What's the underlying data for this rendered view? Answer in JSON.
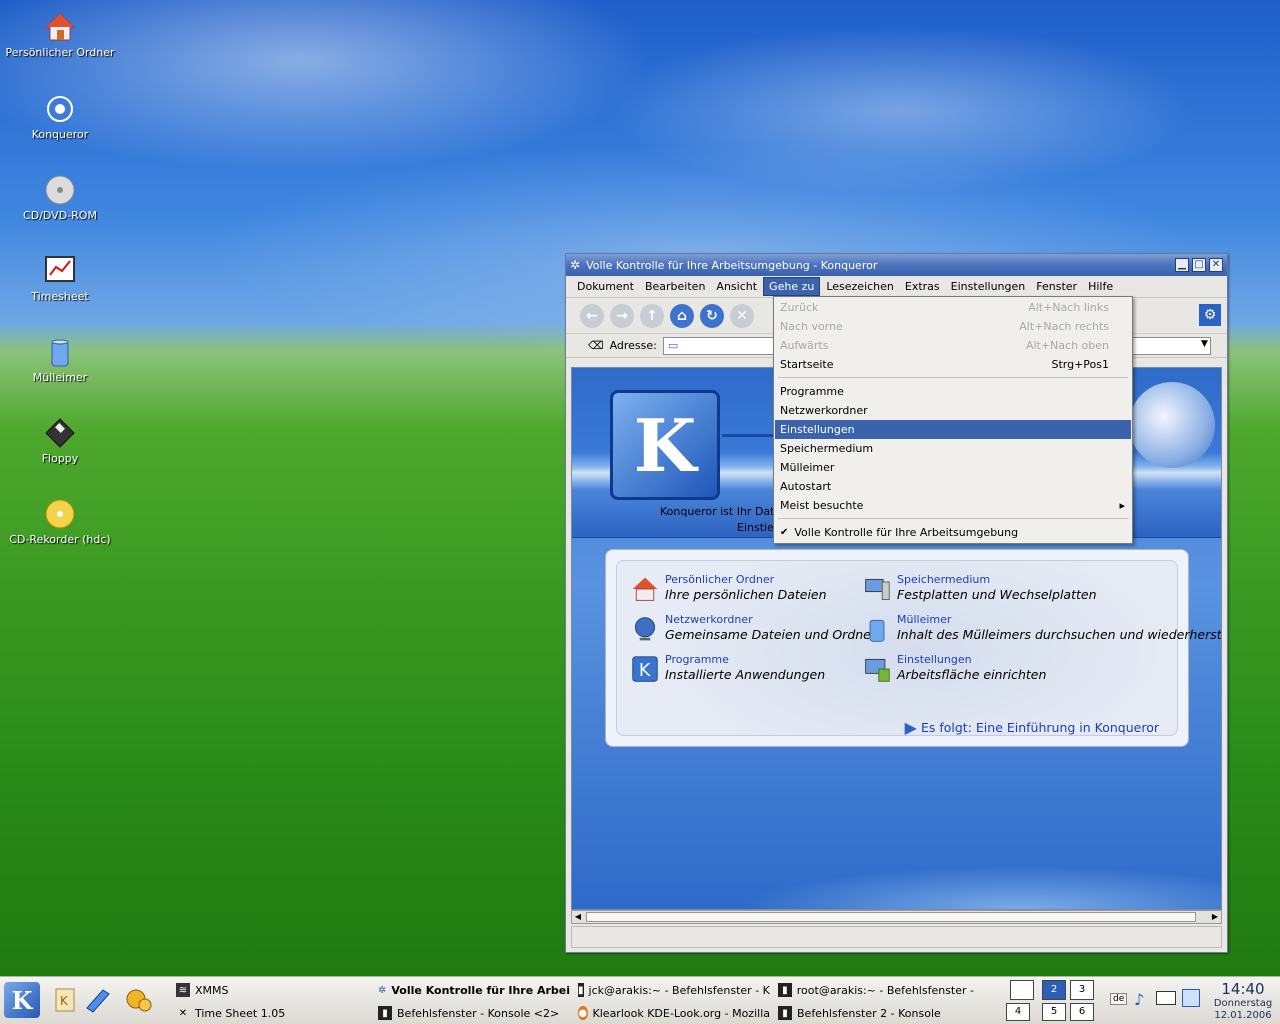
{
  "desktop": {
    "icons": [
      {
        "label": "Persönlicher Ordner",
        "icon": "home-folder-icon"
      },
      {
        "label": "Konqueror",
        "icon": "konqueror-globe-icon"
      },
      {
        "label": "CD/DVD-ROM",
        "icon": "cdrom-icon"
      },
      {
        "label": "Timesheet",
        "icon": "timesheet-icon"
      },
      {
        "label": "Mülleimer",
        "icon": "trash-icon"
      },
      {
        "label": "Floppy",
        "icon": "floppy-icon"
      },
      {
        "label": "CD-Rekorder (hdc)",
        "icon": "cd-writer-icon"
      }
    ]
  },
  "window": {
    "title": "Volle Kontrolle für Ihre Arbeitsumgebung - Konqueror",
    "controls": {
      "minimize": "▁",
      "maximize": "□",
      "close": "✕"
    },
    "menu": [
      "Dokument",
      "Bearbeiten",
      "Ansicht",
      "Gehe zu",
      "Lesezeichen",
      "Extras",
      "Einstellungen",
      "Fenster",
      "Hilfe"
    ],
    "active_menu": "Gehe zu",
    "address_label": "Adresse:",
    "banner_text": [
      "Konqueror ist Ihr Dat",
      "Einstie"
    ],
    "links": [
      {
        "title": "Persönlicher Ordner",
        "desc": "Ihre persönlichen Dateien",
        "icon": "home-folder-icon"
      },
      {
        "title": "Speichermedium",
        "desc": "Festplatten und Wechselplatten",
        "icon": "storage-media-icon"
      },
      {
        "title": "Netzwerkordner",
        "desc": "Gemeinsame Dateien und Ordner",
        "icon": "network-folder-icon"
      },
      {
        "title": "Mülleimer",
        "desc": "Inhalt des Mülleimers durchsuchen und wiederherstelle",
        "icon": "trash-icon"
      },
      {
        "title": "Programme",
        "desc": "Installierte Anwendungen",
        "icon": "applications-icon"
      },
      {
        "title": "Einstellungen",
        "desc": "Arbeitsfläche einrichten",
        "icon": "settings-icon"
      }
    ],
    "next_link": "Es folgt: Eine Einführung in Konqueror"
  },
  "gehezu_menu": {
    "items": [
      {
        "label": "Zurück",
        "shortcut": "Alt+Nach links",
        "disabled": true
      },
      {
        "label": "Nach vorne",
        "shortcut": "Alt+Nach rechts",
        "disabled": true
      },
      {
        "label": "Aufwärts",
        "shortcut": "Alt+Nach oben",
        "disabled": true
      },
      {
        "label": "Startseite",
        "shortcut": "Strg+Pos1",
        "disabled": false
      },
      {
        "label": "Programme",
        "shortcut": "",
        "disabled": false
      },
      {
        "label": "Netzwerkordner",
        "shortcut": "",
        "disabled": false
      },
      {
        "label": "Einstellungen",
        "shortcut": "",
        "disabled": false,
        "selected": true
      },
      {
        "label": "Speichermedium",
        "shortcut": "",
        "disabled": false
      },
      {
        "label": "Mülleimer",
        "shortcut": "",
        "disabled": false
      },
      {
        "label": "Autostart",
        "shortcut": "",
        "disabled": false
      },
      {
        "label": "Meist besuchte",
        "shortcut": "",
        "disabled": false,
        "submenu": true
      },
      {
        "label": "Volle Kontrolle für Ihre Arbeitsumgebung",
        "shortcut": "",
        "disabled": false,
        "checked": true
      }
    ],
    "submenu_arrow": "▸",
    "check_mark": "✔"
  },
  "taskbar": {
    "tasks": [
      {
        "label": "XMMS",
        "icon": "xmms-icon"
      },
      {
        "label": "Time Sheet 1.05",
        "icon": "x-icon"
      },
      {
        "label": "Volle Kontrolle für Ihre Arbeit",
        "icon": "konqueror-icon",
        "active": true
      },
      {
        "label": "Befehlsfenster - Konsole <2>",
        "icon": "konsole-icon"
      },
      {
        "label": "jck@arakis:~ - Befehlsfenster - Ko",
        "icon": "konsole-icon"
      },
      {
        "label": "Klearlook KDE-Look.org - Mozilla",
        "icon": "firefox-icon"
      },
      {
        "label": "root@arakis:~ - Befehlsfenster -",
        "icon": "konsole-icon"
      },
      {
        "label": "Befehlsfenster 2 - Konsole",
        "icon": "konsole-icon"
      }
    ],
    "pager": [
      "2",
      "3",
      "4",
      "5",
      "6"
    ],
    "clock": {
      "time": "14:40",
      "day": "Donnerstag",
      "date": "12.01.2006"
    }
  }
}
